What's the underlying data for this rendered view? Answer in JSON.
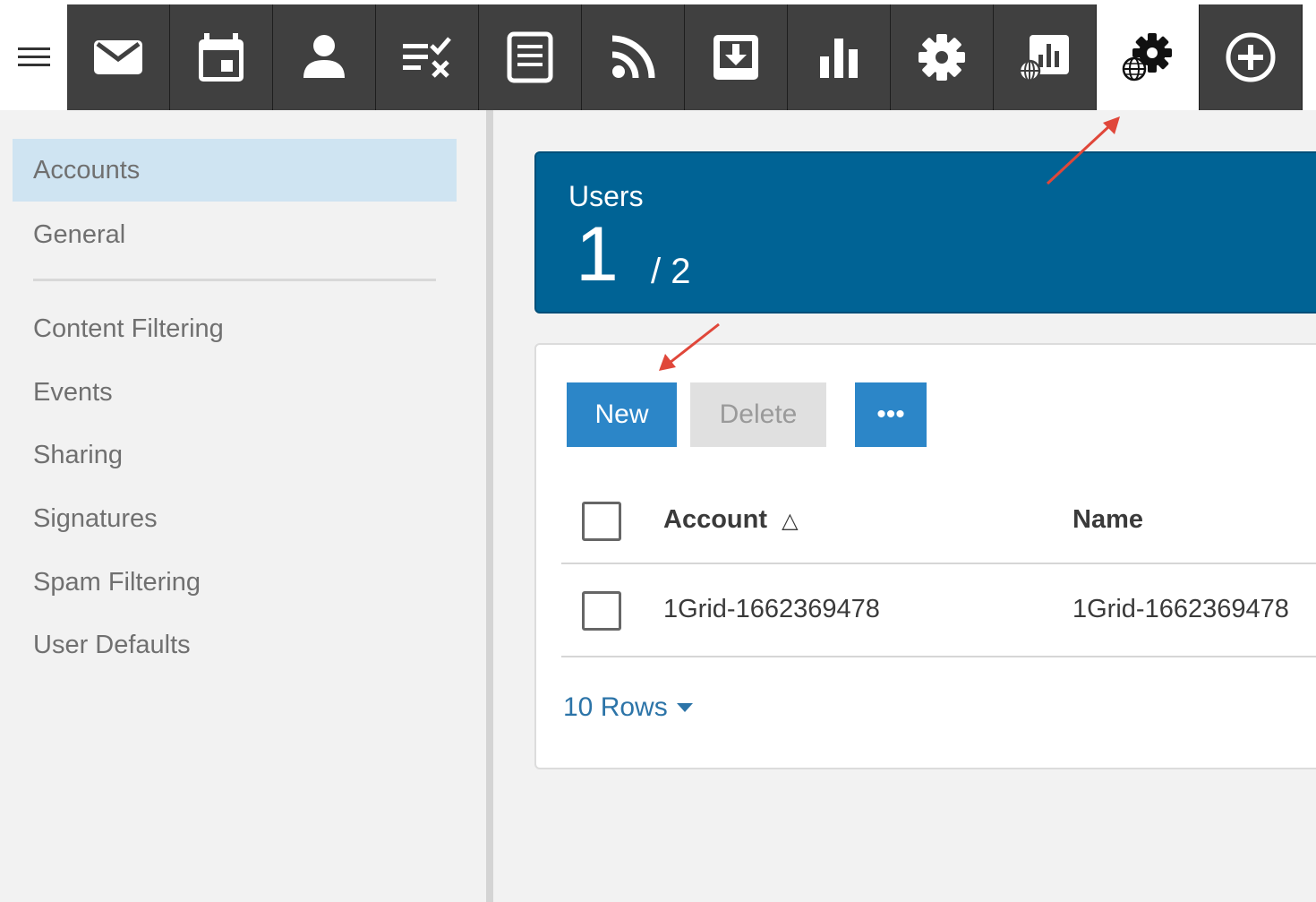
{
  "toolbar": {
    "items": [
      {
        "icon": "mail-icon"
      },
      {
        "icon": "calendar-icon"
      },
      {
        "icon": "contacts-icon"
      },
      {
        "icon": "tasks-icon"
      },
      {
        "icon": "notes-icon"
      },
      {
        "icon": "rss-icon"
      },
      {
        "icon": "downloads-icon"
      },
      {
        "icon": "reports-icon"
      },
      {
        "icon": "settings-icon"
      },
      {
        "icon": "domain-reports-icon"
      },
      {
        "icon": "domain-settings-icon",
        "active": true
      },
      {
        "icon": "add-icon"
      }
    ]
  },
  "sidebar": {
    "items": [
      {
        "label": "Accounts",
        "active": true
      },
      {
        "label": "General"
      },
      {
        "label": "Content Filtering"
      },
      {
        "label": "Events"
      },
      {
        "label": "Sharing"
      },
      {
        "label": "Signatures"
      },
      {
        "label": "Spam Filtering"
      },
      {
        "label": "User Defaults"
      }
    ]
  },
  "users_card": {
    "title": "Users",
    "count": "1",
    "total": "/ 2"
  },
  "actions": {
    "new_label": "New",
    "delete_label": "Delete",
    "more_label": "•••"
  },
  "table": {
    "columns": [
      "Account",
      "Name"
    ],
    "sort_indicator": "△",
    "rows": [
      {
        "account": "1Grid-1662369478",
        "name": "1Grid-1662369478"
      }
    ]
  },
  "pagination": {
    "rows_label": "10 Rows"
  },
  "colors": {
    "toolbar_bg": "#404040",
    "accent": "#2c86c8",
    "card_bg": "#006395",
    "annotation_arrow": "#e0473a"
  }
}
